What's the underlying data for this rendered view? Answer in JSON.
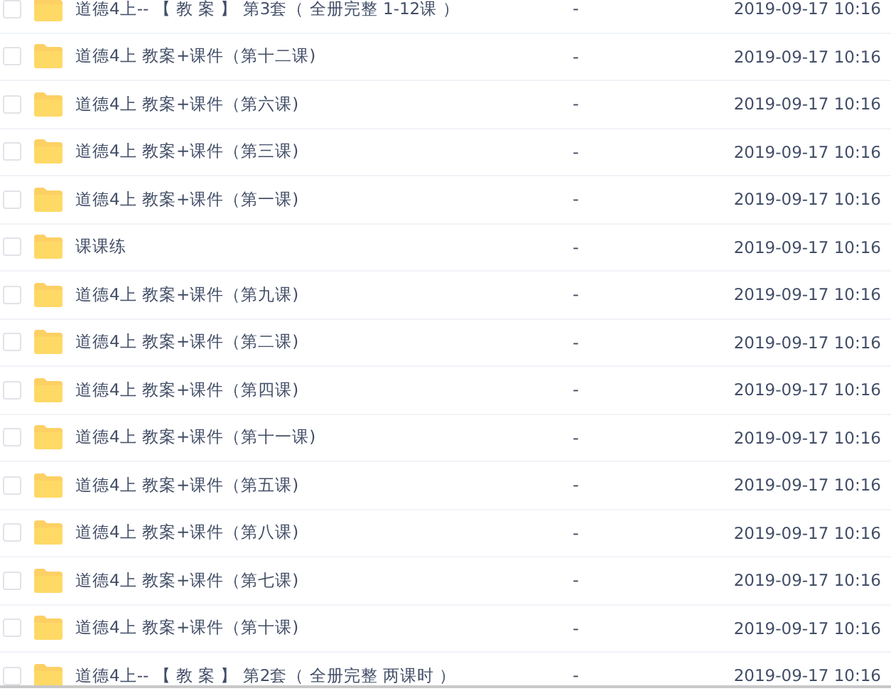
{
  "files": [
    {
      "name": "道德4上-- 【 教 案 】 第3套（ 全册完整 1-12课 ）",
      "size": "-",
      "modified": "2019-09-17 10:16",
      "checked": false
    },
    {
      "name": "道德4上 教案+课件（第十二课)",
      "size": "-",
      "modified": "2019-09-17 10:16",
      "checked": false
    },
    {
      "name": "道德4上 教案+课件（第六课)",
      "size": "-",
      "modified": "2019-09-17 10:16",
      "checked": false
    },
    {
      "name": "道德4上 教案+课件（第三课)",
      "size": "-",
      "modified": "2019-09-17 10:16",
      "checked": false
    },
    {
      "name": "道德4上 教案+课件（第一课)",
      "size": "-",
      "modified": "2019-09-17 10:16",
      "checked": false
    },
    {
      "name": "课课练",
      "size": "-",
      "modified": "2019-09-17 10:16",
      "checked": false
    },
    {
      "name": "道德4上 教案+课件（第九课)",
      "size": "-",
      "modified": "2019-09-17 10:16",
      "checked": false
    },
    {
      "name": "道德4上 教案+课件（第二课)",
      "size": "-",
      "modified": "2019-09-17 10:16",
      "checked": false
    },
    {
      "name": "道德4上 教案+课件（第四课)",
      "size": "-",
      "modified": "2019-09-17 10:16",
      "checked": false
    },
    {
      "name": "道德4上 教案+课件（第十一课)",
      "size": "-",
      "modified": "2019-09-17 10:16",
      "checked": false
    },
    {
      "name": "道德4上 教案+课件（第五课)",
      "size": "-",
      "modified": "2019-09-17 10:16",
      "checked": false
    },
    {
      "name": "道德4上 教案+课件（第八课)",
      "size": "-",
      "modified": "2019-09-17 10:16",
      "checked": false
    },
    {
      "name": "道德4上 教案+课件（第七课)",
      "size": "-",
      "modified": "2019-09-17 10:16",
      "checked": false
    },
    {
      "name": "道德4上 教案+课件（第十课)",
      "size": "-",
      "modified": "2019-09-17 10:16",
      "checked": false
    },
    {
      "name": "道德4上-- 【 教 案 】 第2套（ 全册完整 两课时 ）",
      "size": "-",
      "modified": "2019-09-17 10:16",
      "checked": false
    }
  ]
}
